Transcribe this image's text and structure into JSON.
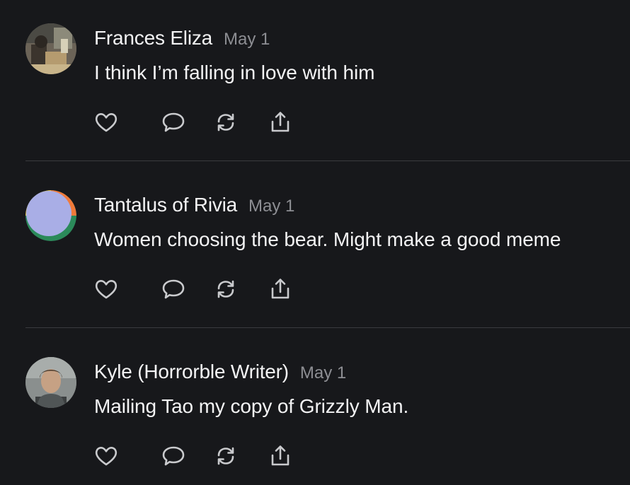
{
  "colors": {
    "background": "#17181b",
    "text": "#f3f3f4",
    "muted": "#8d8e93",
    "divider": "#3a3b3f",
    "icon": "#c9cacd"
  },
  "posts": [
    {
      "author": "Frances Eliza",
      "date": "May 1",
      "text": "I think I’m falling in love with him",
      "avatar": "photo-avatar"
    },
    {
      "author": "Tantalus of Rivia",
      "date": "May 1",
      "text": "Women choosing the bear. Might make a good meme",
      "avatar": "abstract-avatar"
    },
    {
      "author": "Kyle (Horrorble Writer)",
      "date": "May 1",
      "text": "Mailing Tao my copy of Grizzly Man.",
      "avatar": "photo-avatar"
    }
  ],
  "actions": {
    "like": "heart-icon",
    "reply": "speech-bubble-icon",
    "repost": "repost-icon",
    "share": "share-icon"
  }
}
